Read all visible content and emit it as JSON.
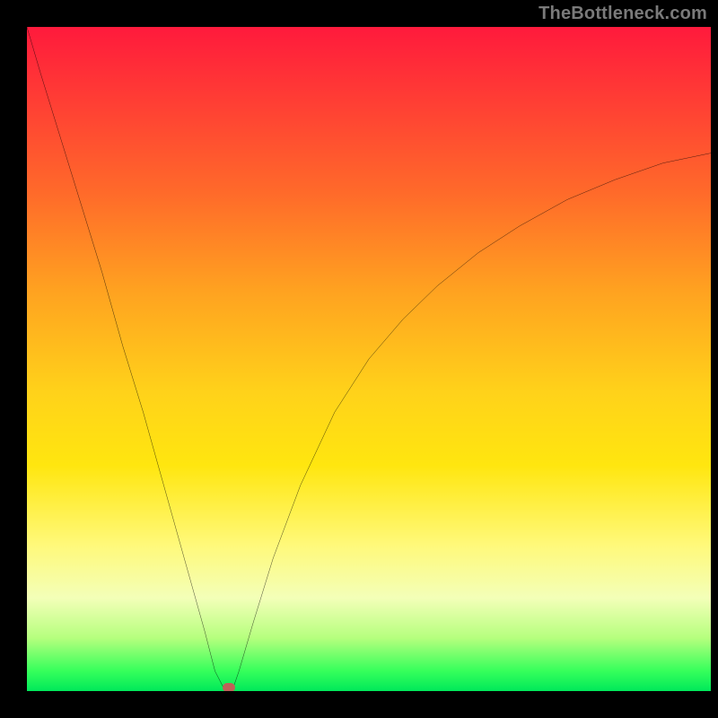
{
  "watermark": "TheBottleneck.com",
  "chart_data": {
    "type": "line",
    "title": "",
    "xlabel": "",
    "ylabel": "",
    "xlim": [
      0,
      100
    ],
    "ylim": [
      0,
      100
    ],
    "grid": false,
    "legend": false,
    "background": "vertical gradient red→orange→yellow→green (top→bottom)",
    "series": [
      {
        "name": "bottleneck-curve",
        "color": "#000000",
        "x": [
          0,
          2,
          5,
          8,
          11,
          14,
          17,
          20,
          23,
          26,
          27.5,
          29,
          30,
          31,
          33,
          36,
          40,
          45,
          50,
          55,
          60,
          66,
          72,
          79,
          86,
          93,
          100
        ],
        "y": [
          100,
          93,
          83,
          73,
          63,
          52,
          42,
          31,
          20,
          9,
          3,
          0,
          0,
          3,
          10,
          20,
          31,
          42,
          50,
          56,
          61,
          66,
          70,
          74,
          77,
          79.5,
          81
        ]
      }
    ],
    "annotations": [
      {
        "name": "minimum-marker",
        "x": 29.5,
        "y": 0.5,
        "color": "#c06058"
      }
    ]
  }
}
